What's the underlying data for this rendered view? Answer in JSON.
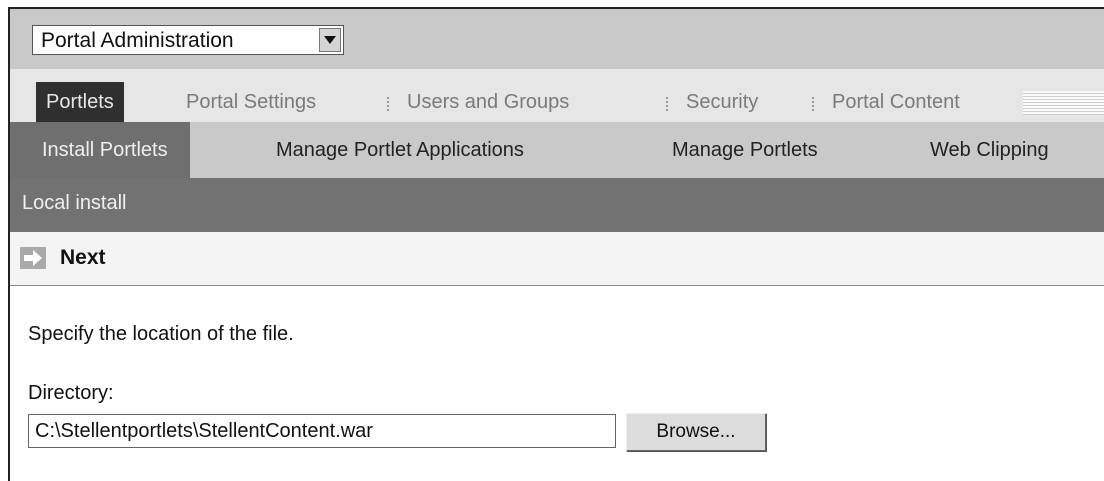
{
  "portal_select": {
    "value": "Portal Administration"
  },
  "main_tabs": [
    {
      "label": "Portlets",
      "active": true
    },
    {
      "label": "Portal Settings",
      "active": false
    },
    {
      "label": "Users and Groups",
      "active": false
    },
    {
      "label": "Security",
      "active": false
    },
    {
      "label": "Portal Content",
      "active": false
    }
  ],
  "sub_tabs": [
    {
      "label": "Install Portlets",
      "active": true
    },
    {
      "label": "Manage Portlet Applications",
      "active": false
    },
    {
      "label": "Manage Portlets",
      "active": false
    },
    {
      "label": "Web Clipping",
      "active": false
    }
  ],
  "section": {
    "title": "Local install"
  },
  "next": {
    "label": "Next",
    "icon": "arrow-right-icon"
  },
  "form": {
    "instruction": "Specify the location of the file.",
    "directory_label": "Directory:",
    "directory_value": "C:\\Stellentportlets\\StellentContent.war",
    "browse_label": "Browse..."
  },
  "colors": {
    "topbar": "#c8c8c8",
    "active_tab": "#2f2f2f",
    "active_subtab": "#6f6f6f",
    "section_bar": "#727272"
  }
}
